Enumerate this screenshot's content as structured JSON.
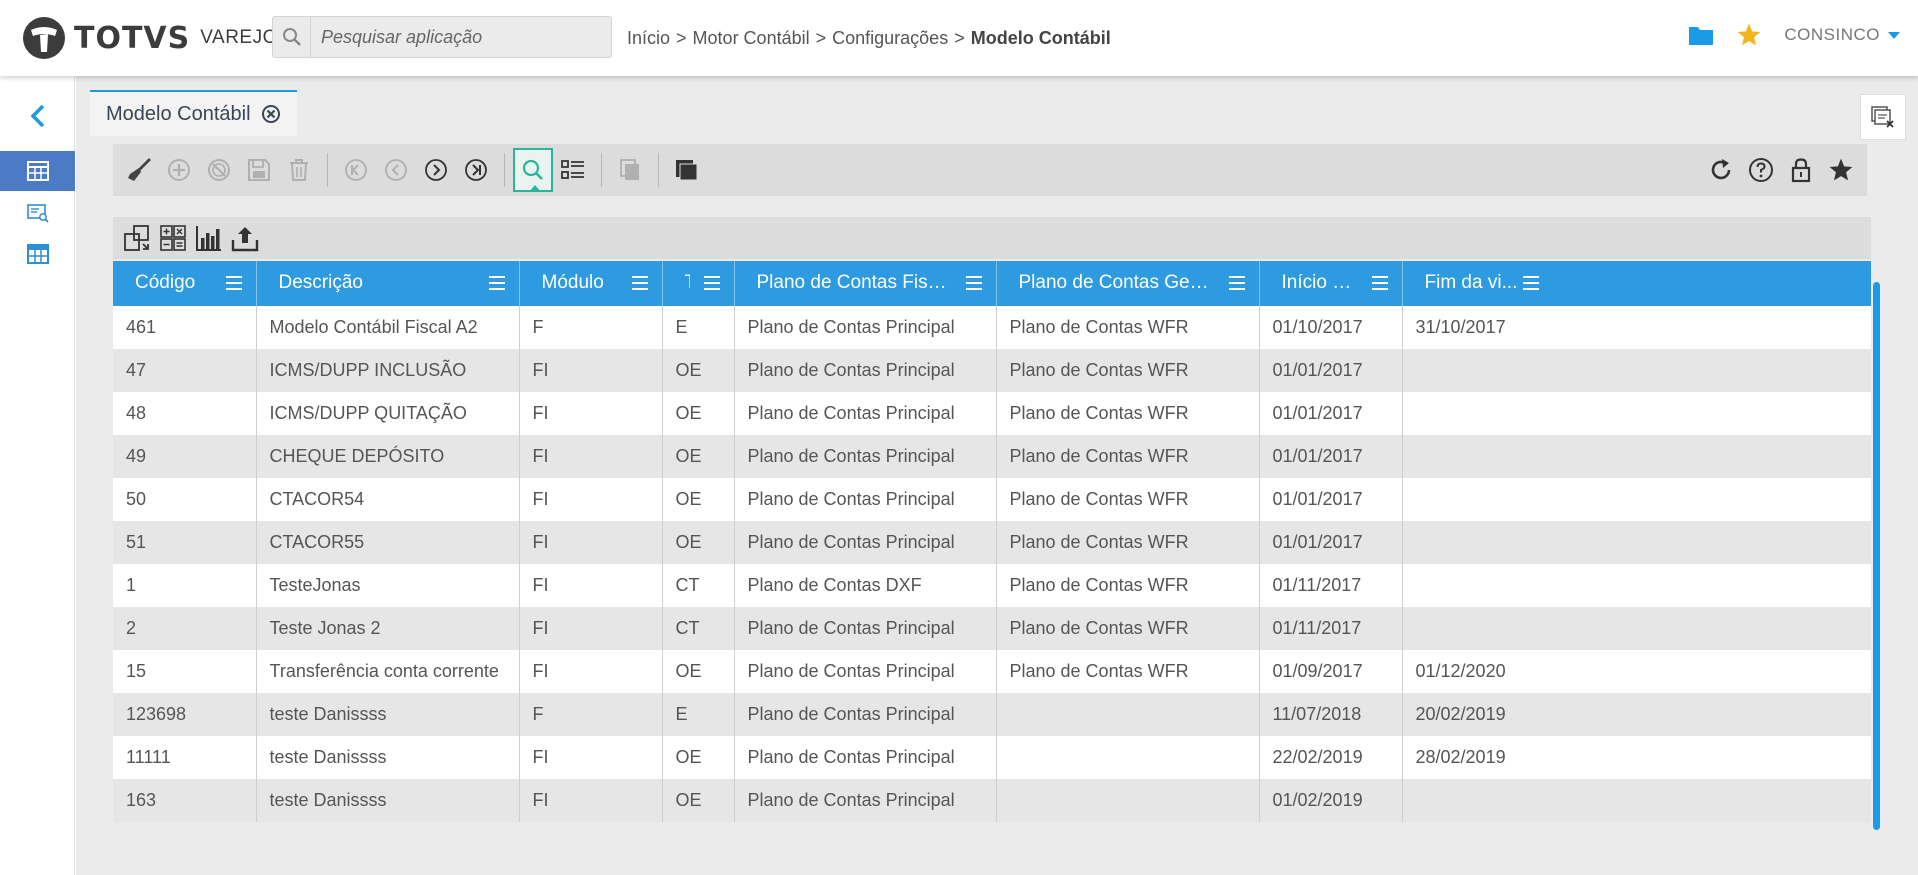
{
  "header": {
    "logo_text": "TOTVS",
    "logo_sub": "VAREJO",
    "search_placeholder": "Pesquisar aplicação",
    "breadcrumb": [
      "Início",
      "Motor Contábil",
      "Configurações",
      "Modelo Contábil"
    ],
    "breadcrumb_sep": ">",
    "user": "CONSINCO",
    "icons": [
      "folder-icon",
      "star-icon"
    ],
    "colors": {
      "accent": "#1a9be6",
      "star": "#f3b51f"
    }
  },
  "sidebar": {
    "items": [
      {
        "icon": "back-chevron-icon"
      },
      {
        "icon": "calendar-grid-icon",
        "active": true
      },
      {
        "icon": "monitor-search-icon"
      },
      {
        "icon": "table-grid-icon"
      }
    ]
  },
  "tab": {
    "label": "Modelo Contábil"
  },
  "toolbar": {
    "left": [
      "broom-icon",
      "add-icon",
      "cancel-icon",
      "save-icon",
      "delete-icon",
      "first-icon",
      "previous-icon",
      "next-icon",
      "last-icon",
      "search-icon",
      "list-view-icon",
      "copy-icon",
      "layers-icon"
    ],
    "right": [
      "refresh-icon",
      "help-icon",
      "lock-icon",
      "favorite-star-icon"
    ]
  },
  "grid": {
    "header_color": "#2e9be0",
    "columns": [
      "Código",
      "Descrição",
      "Módulo",
      "T...",
      "Plano de Contas Fiscal",
      "Plano de Contas Gerencial",
      "Início da ...",
      "Fim da vi..."
    ],
    "rows": [
      [
        "461",
        "Modelo Contábil Fiscal A2",
        "F",
        "E",
        "Plano de Contas Principal",
        "Plano de Contas WFR",
        "01/10/2017",
        "31/10/2017"
      ],
      [
        "47",
        "ICMS/DUPP INCLUSÃO",
        "FI",
        "OE",
        "Plano de Contas Principal",
        "Plano de Contas WFR",
        "01/01/2017",
        ""
      ],
      [
        "48",
        "ICMS/DUPP QUITAÇÃO",
        "FI",
        "OE",
        "Plano de Contas Principal",
        "Plano de Contas WFR",
        "01/01/2017",
        ""
      ],
      [
        "49",
        "CHEQUE DEPÓSITO",
        "FI",
        "OE",
        "Plano de Contas Principal",
        "Plano de Contas WFR",
        "01/01/2017",
        ""
      ],
      [
        "50",
        "CTACOR54",
        "FI",
        "OE",
        "Plano de Contas Principal",
        "Plano de Contas WFR",
        "01/01/2017",
        ""
      ],
      [
        "51",
        "CTACOR55",
        "FI",
        "OE",
        "Plano de Contas Principal",
        "Plano de Contas WFR",
        "01/01/2017",
        ""
      ],
      [
        "1",
        "TesteJonas",
        "FI",
        "CT",
        "Plano de Contas DXF",
        "Plano de Contas WFR",
        "01/11/2017",
        ""
      ],
      [
        "2",
        "Teste Jonas 2",
        "FI",
        "CT",
        "Plano de Contas Principal",
        "Plano de Contas WFR",
        "01/11/2017",
        ""
      ],
      [
        "15",
        "Transferência conta corrente",
        "FI",
        "OE",
        "Plano de Contas Principal",
        "Plano de Contas WFR",
        "01/09/2017",
        "01/12/2020"
      ],
      [
        "123698",
        "teste Danissss",
        "F",
        "E",
        "Plano de Contas Principal",
        "",
        "11/07/2018",
        "20/02/2019"
      ],
      [
        "11111",
        "teste Danissss",
        "FI",
        "OE",
        "Plano de Contas Principal",
        "",
        "22/02/2019",
        "28/02/2019"
      ],
      [
        "163",
        "teste Danissss",
        "FI",
        "OE",
        "Plano de Contas Principal",
        "",
        "01/02/2019",
        ""
      ]
    ]
  }
}
